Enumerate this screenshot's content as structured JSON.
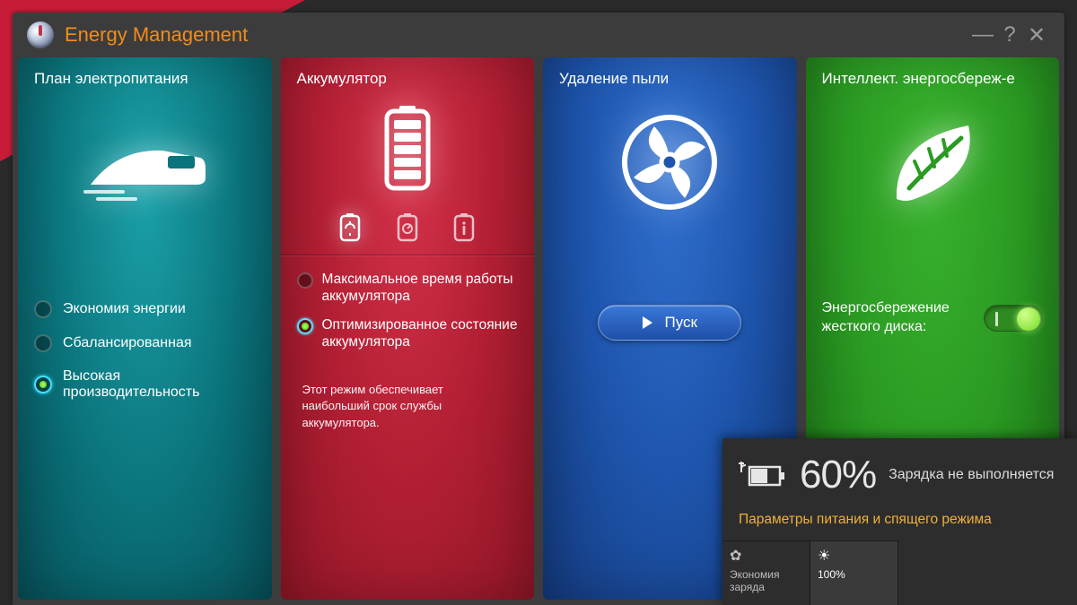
{
  "app_title": "Energy Management",
  "power_plan": {
    "title": "План электропитания",
    "options": [
      {
        "label": "Экономия энергии",
        "selected": false
      },
      {
        "label": "Сбалансированная",
        "selected": false
      },
      {
        "label": "Высокая производительность",
        "selected": true
      }
    ]
  },
  "battery": {
    "title": "Аккумулятор",
    "options": [
      {
        "label": "Максимальное время работы аккумулятора",
        "selected": false
      },
      {
        "label": "Оптимизированное состояние аккумулятора",
        "selected": true
      }
    ],
    "description": "Этот режим обеспечивает наибольший срок службы аккумулятора."
  },
  "dust": {
    "title": "Удаление пыли",
    "button": "Пуск"
  },
  "eco": {
    "title": "Интеллект. энергосбереж-е",
    "row_label": "Энергосбережение жесткого диска:",
    "toggle_on": true
  },
  "flyout": {
    "percent": "60%",
    "status": "Зарядка не выполняется",
    "link": "Параметры питания и спящего режима",
    "mode_economy_label": "Экономия заряда",
    "mode_bright_value": "100%"
  }
}
